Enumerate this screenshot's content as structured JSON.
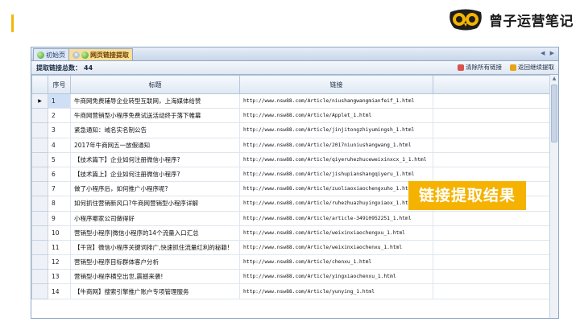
{
  "brand": {
    "name": "曾子运营笔记",
    "accent_color": "#f2b705"
  },
  "tabs": [
    {
      "label": "初始页",
      "icon": "home-icon"
    },
    {
      "label": "网页链接提取",
      "icon": "tool-icon",
      "active": true
    }
  ],
  "toolbar": {
    "total_label": "提取链接总数：",
    "total_value": "44",
    "clear_label": "清除所有链接",
    "back_label": "返回继续提取"
  },
  "grid": {
    "columns": [
      "序号",
      "标题",
      "链接"
    ],
    "rows": [
      {
        "num": "1",
        "title": "牛商网免费辅导企业转型互联网，上海媒体给赞",
        "url": "http://www.nsw88.com/Article/niushangwangmianfeif_1.html"
      },
      {
        "num": "2",
        "title": "牛商网营销型小程序免费试送活动终于落下帷幕",
        "url": "http://www.nsw88.com/Article/Applet_1.html"
      },
      {
        "num": "3",
        "title": "紧急通知：域名实名制公告",
        "url": "http://www.nsw88.com/Article/jinjitongzhiyumingsh_1.html"
      },
      {
        "num": "4",
        "title": "2017年牛商网五一放假通知",
        "url": "http://www.nsw88.com/Article/2017niuniushangwang_1.html"
      },
      {
        "num": "5",
        "title": "【技术篇下】企业如何注册微信小程序?",
        "url": "http://www.nsw88.com/Article/qiyeruhezhuceweixinxcx_1_1.html"
      },
      {
        "num": "6",
        "title": "【技术篇上】企业如何注册微信小程序?",
        "url": "http://www.nsw88.com/Article/jishupianshangqiyeru_1.html"
      },
      {
        "num": "7",
        "title": "做了小程序后，如何推广小程序呢?",
        "url": "http://www.nsw88.com/Article/zuoliaoxiaochengxuho_1.html"
      },
      {
        "num": "8",
        "title": "如何抓住营销新风口?牛商网营销型小程序详解",
        "url": "http://www.nsw88.com/Article/ruhezhuazhuyingxiaox_1.html"
      },
      {
        "num": "9",
        "title": "小程序哪家公司做得好",
        "url": "http://www.nsw88.com/Article/article-34910952251_1.html"
      },
      {
        "num": "10",
        "title": "营销型小程序|微信小程序的14个流量入口汇总",
        "url": "http://www.nsw88.com/Article/weixinxiaochengxu_1.html"
      },
      {
        "num": "11",
        "title": "【干货】微信小程序关键词排广,快速抓住流量红利的秘籍!",
        "url": "http://www.nsw88.com/Article/weixinxiaochenxu_1.html"
      },
      {
        "num": "12",
        "title": "营销型小程序目标群体客户分析",
        "url": "http://www.nsw88.com/Article/chenxu_1.html"
      },
      {
        "num": "13",
        "title": "营销型小程序横空出世,震撼来袭!",
        "url": "http://www.nsw88.com/Article/yingxiaochenxu_1.html"
      },
      {
        "num": "14",
        "title": "【牛商网】搜索引擎推广账户专项管理服务",
        "url": "http://www.nsw88.com/Article/yunying_1.html"
      }
    ]
  },
  "callout": {
    "text": "链接提取结果",
    "color": "#f5b200"
  }
}
